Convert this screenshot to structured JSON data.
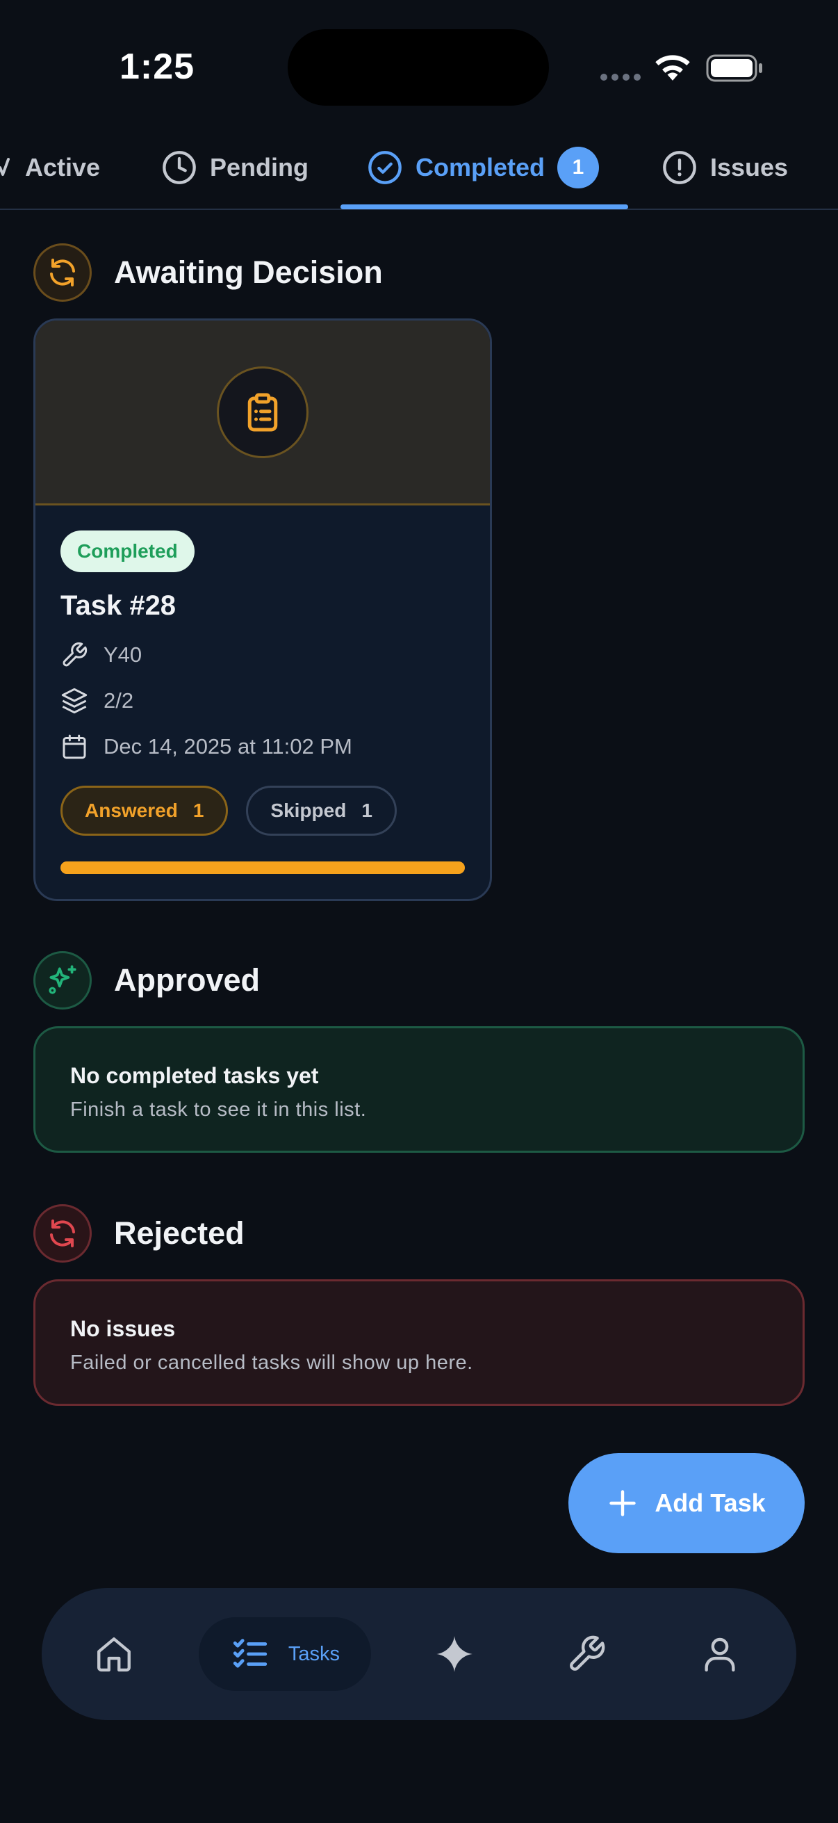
{
  "status_bar": {
    "time": "1:25"
  },
  "tabs": [
    {
      "label": "Active",
      "icon": "activity-icon"
    },
    {
      "label": "Pending",
      "icon": "clock-icon"
    },
    {
      "label": "Completed",
      "icon": "check-circle-icon",
      "count": "1",
      "active": true
    },
    {
      "label": "Issues",
      "icon": "alert-circle-icon"
    }
  ],
  "sections": {
    "awaiting": {
      "title": "Awaiting Decision",
      "icon": "refresh-icon",
      "color": "#f2a22a"
    },
    "approved": {
      "title": "Approved",
      "icon": "sparkles-icon",
      "color": "#22b47a"
    },
    "rejected": {
      "title": "Rejected",
      "icon": "refresh-icon",
      "color": "#e0474f"
    }
  },
  "task_card": {
    "hero_icon": "clipboard-list-icon",
    "status": "Completed",
    "title": "Task #28",
    "tool": "Y40",
    "layers": "2/2",
    "date": "Dec 14, 2025 at 11:02 PM",
    "answered_label": "Answered",
    "answered_count": "1",
    "skipped_label": "Skipped",
    "skipped_count": "1",
    "progress": 1.0
  },
  "approved_empty": {
    "title": "No completed tasks yet",
    "subtitle": "Finish a task to see it in this list."
  },
  "rejected_empty": {
    "title": "No issues",
    "subtitle": "Failed or cancelled tasks will show up here."
  },
  "fab": {
    "label": "Add Task"
  },
  "bottom_nav": {
    "items": [
      {
        "icon": "home-icon"
      },
      {
        "icon": "list-check-icon",
        "label": "Tasks",
        "active": true
      },
      {
        "icon": "sparkle-icon"
      },
      {
        "icon": "wrench-icon"
      },
      {
        "icon": "user-icon"
      }
    ]
  },
  "colors": {
    "accent": "#5aa0f7",
    "warning": "#f2a22a",
    "success": "#22b47a",
    "danger": "#e0474f",
    "background": "#0b0f16"
  }
}
